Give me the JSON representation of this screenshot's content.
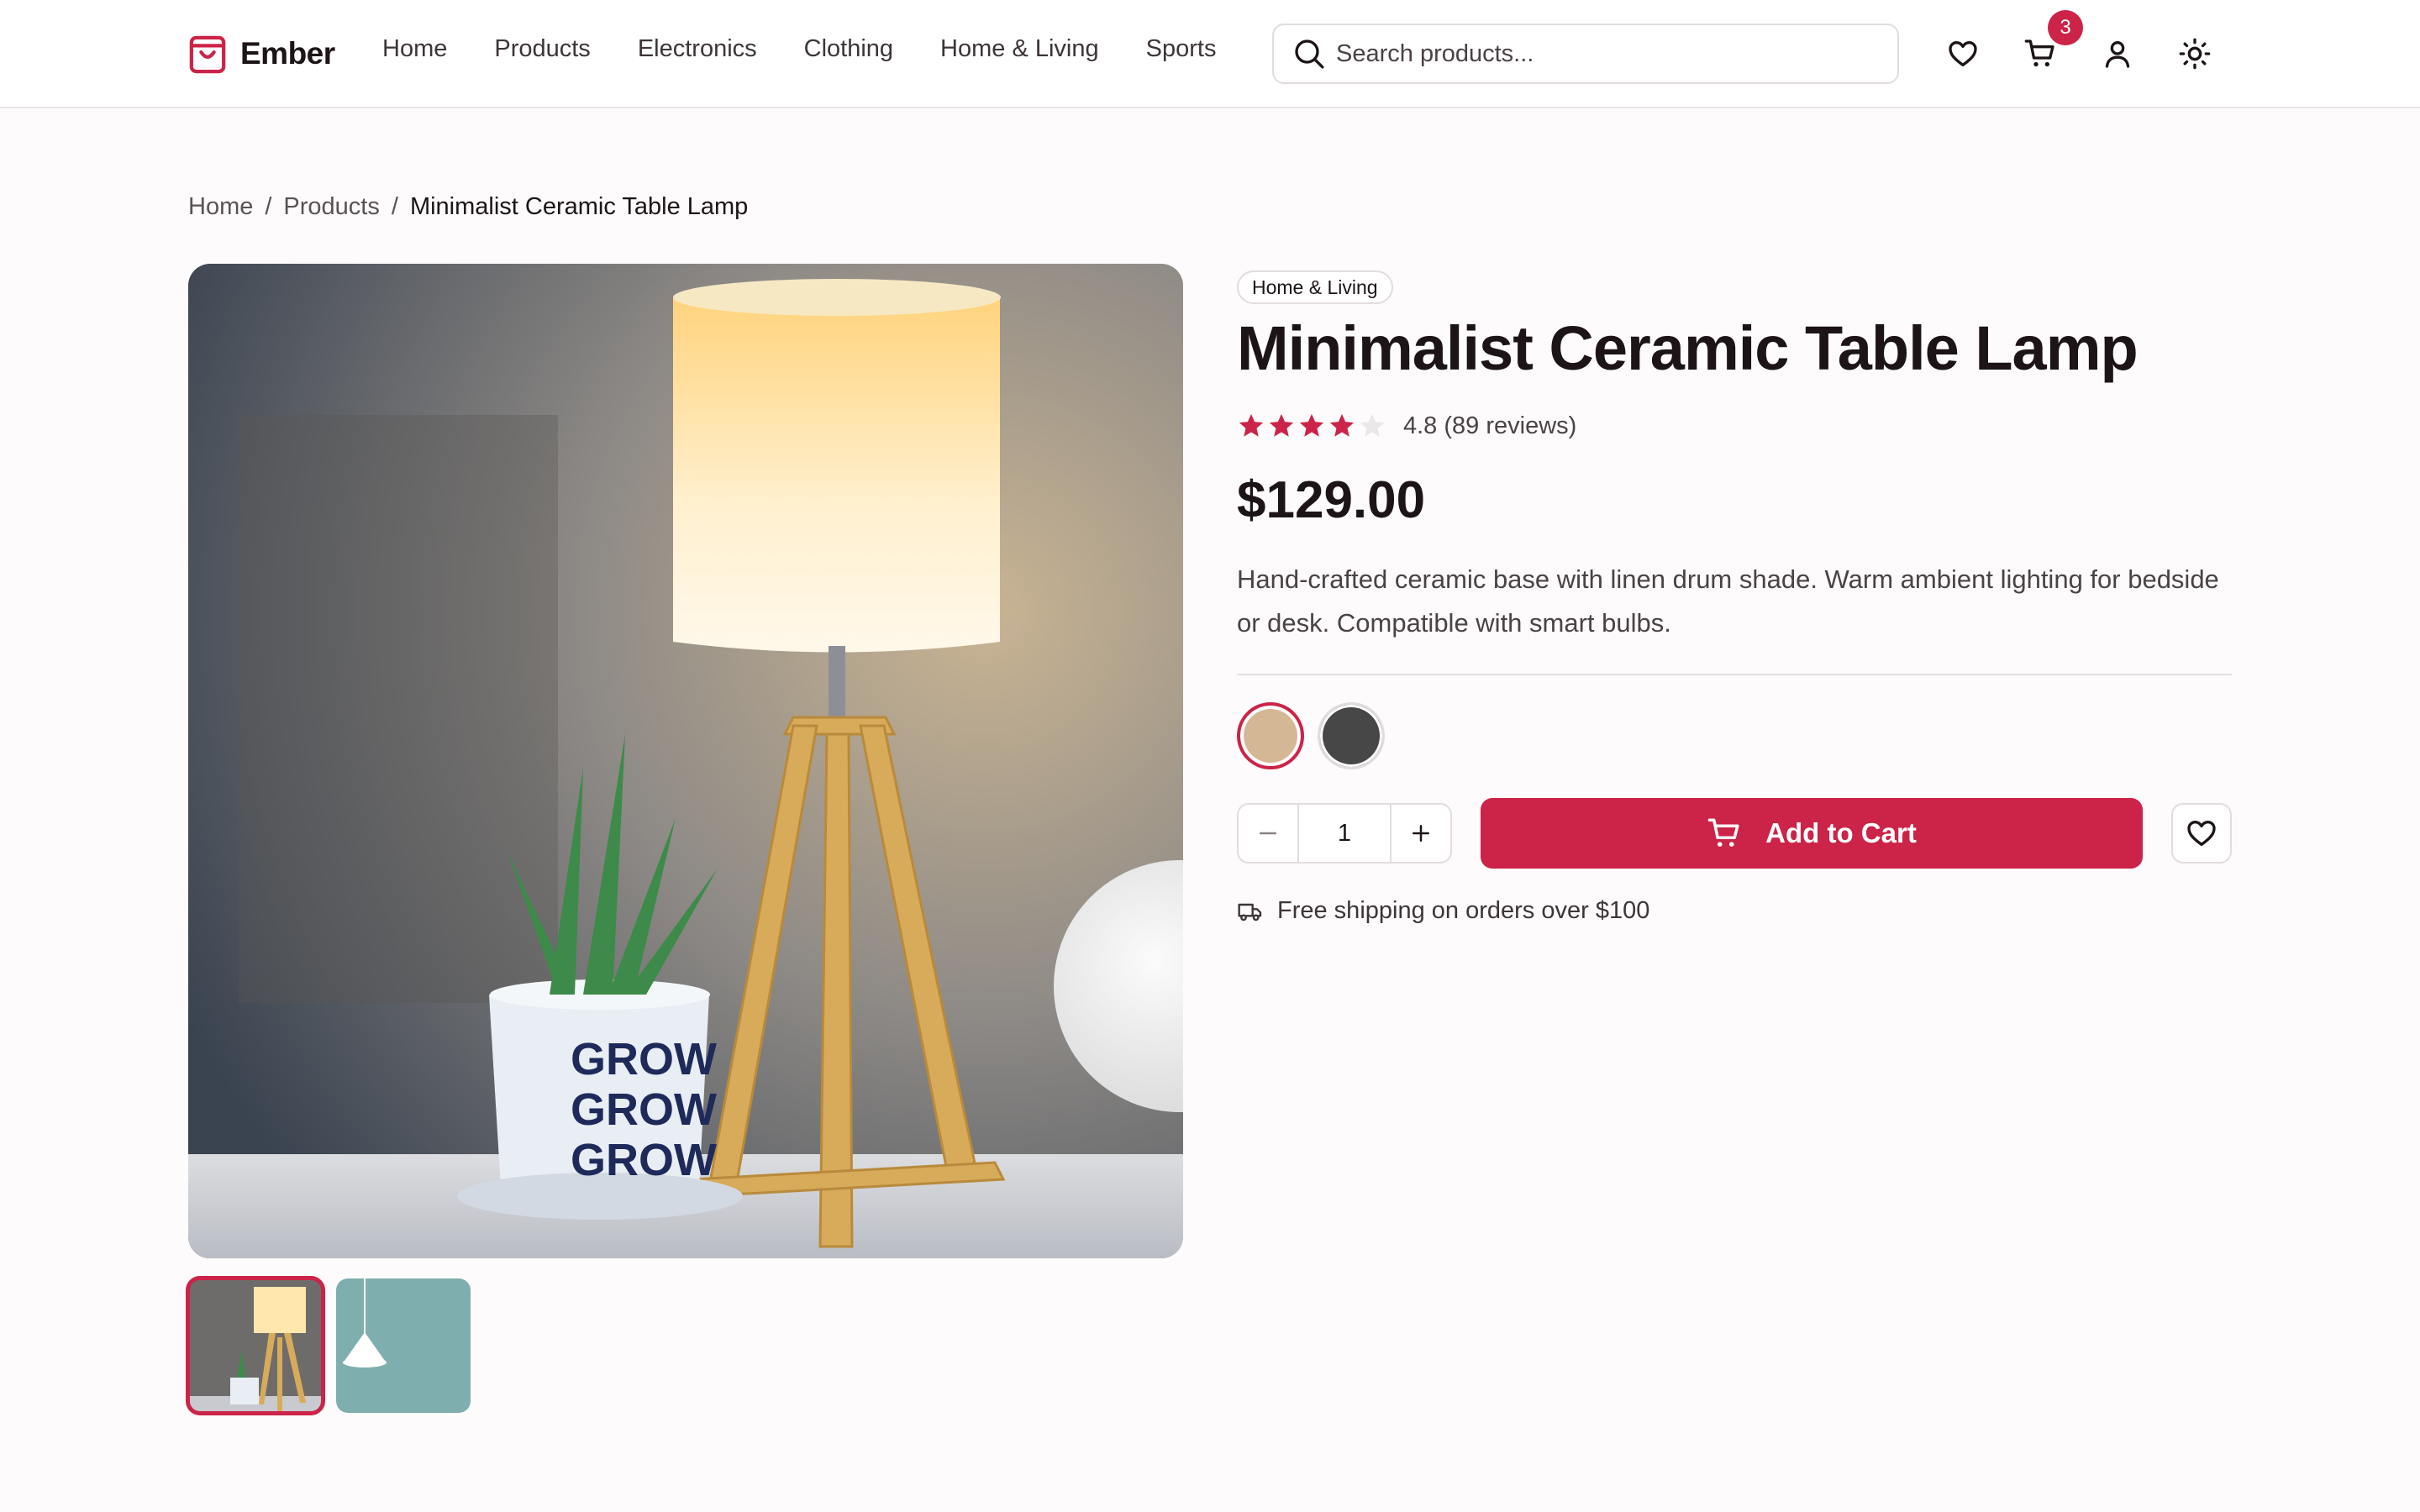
{
  "brand": {
    "name": "Ember",
    "accent": "#cc2348"
  },
  "nav": {
    "items": [
      "Home",
      "Products",
      "Electronics",
      "Clothing",
      "Home & Living",
      "Sports"
    ]
  },
  "search": {
    "placeholder": "Search products...",
    "value": ""
  },
  "header_icons": [
    "heart-icon",
    "cart-icon",
    "user-icon",
    "sun-icon"
  ],
  "cart": {
    "count": "3"
  },
  "breadcrumb": {
    "home": "Home",
    "products": "Products",
    "current": "Minimalist Ceramic Table Lamp",
    "separator": "/"
  },
  "gallery": {
    "images": [
      "ceramic-lamp-photo",
      "pendant-lamp-photo"
    ],
    "selected": 0
  },
  "product": {
    "category": "Home & Living",
    "title": "Minimalist Ceramic Table Lamp",
    "rating": 4.8,
    "rating_text": "4.8 (89 reviews)",
    "stars_filled": 4,
    "stars_total": 5,
    "price": "$129.00",
    "description": "Hand-crafted ceramic base with linen drum shade. Warm ambient lighting for bedside or desk. Compatible with smart bulbs.",
    "colors": [
      {
        "hex": "#d4b896",
        "selected": true
      },
      {
        "hex": "#474747",
        "selected": false
      }
    ],
    "quantity": "1",
    "add_to_cart_label": "Add to Cart",
    "shipping_note": "Free shipping on orders over $100"
  }
}
